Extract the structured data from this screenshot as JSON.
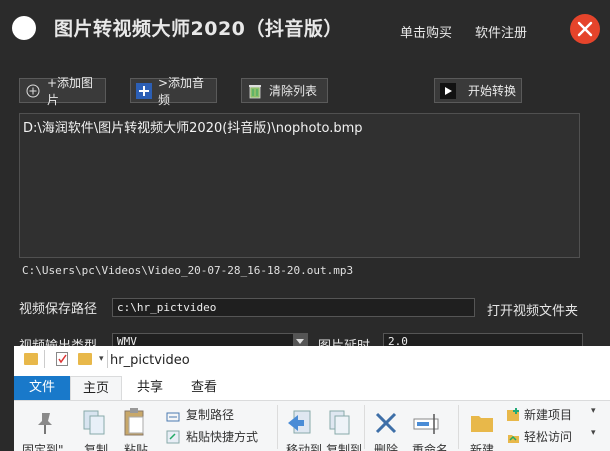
{
  "app": {
    "title": "图片转视频大师2020（抖音版）",
    "buy_link": "单击购买",
    "register_link": "软件注册"
  },
  "toolbar": {
    "add_image": "+添加图片",
    "add_audio": ">添加音频",
    "clear_list": "清除列表",
    "start_convert": "开始转换"
  },
  "file_list": {
    "items": [
      "D:\\海润软件\\图片转视频大师2020(抖音版)\\nophoto.bmp"
    ]
  },
  "audio_path": "C:\\Users\\pc\\Videos\\Video_20-07-28_16-18-20.out.mp3",
  "save": {
    "label": "视频保存路径",
    "value": "c:\\hr_pictvideo",
    "open_folder": "打开视频文件夹"
  },
  "output": {
    "type_label": "视频输出类型",
    "type_value": "WMV",
    "delay_label": "图片延时",
    "delay_value": "2.0"
  },
  "explorer": {
    "title": "hr_pictvideo",
    "tabs": [
      "文件",
      "主页",
      "共享",
      "查看"
    ],
    "ribbon": {
      "copy_path": "复制路径",
      "paste_shortcut": "粘贴快捷方式",
      "new_item": "新建项目",
      "easy_access": "轻松访问",
      "pin_partial": "固定到\"",
      "copy_partial": "复制",
      "paste_partial": "粘贴",
      "move_partial": "移动到",
      "copyto_partial": "复制到",
      "delete_partial": "删除",
      "rename_partial": "重命名",
      "newfolder_partial": "新建"
    }
  },
  "colors": {
    "background": "#2a2a2a",
    "close_button": "#e5442b",
    "explorer_file_tab": "#1979ca"
  }
}
